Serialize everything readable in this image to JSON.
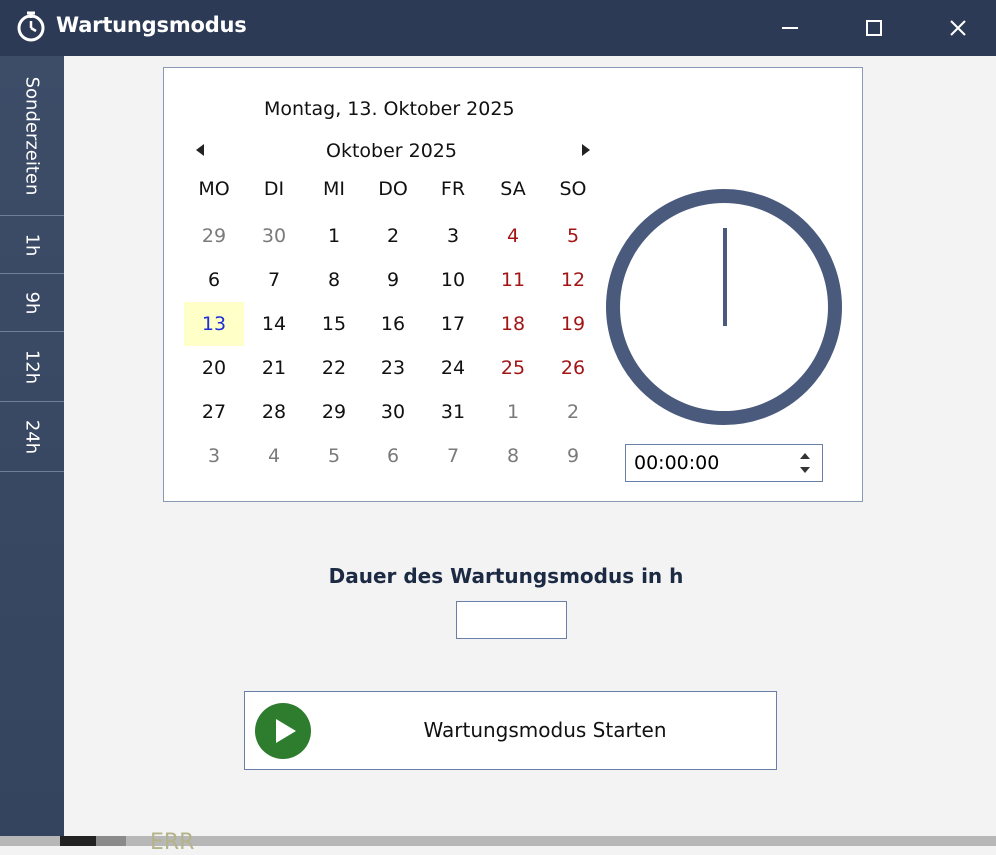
{
  "window": {
    "title": "Wartungsmodus",
    "title_icon": "clock-icon",
    "controls": [
      "minimize-icon",
      "maximize-icon",
      "close-icon"
    ]
  },
  "sidebar": {
    "items": [
      {
        "label": "Sonderzeiten"
      },
      {
        "label": "1h"
      },
      {
        "label": "9h"
      },
      {
        "label": "12h"
      },
      {
        "label": "24h"
      }
    ]
  },
  "calendar": {
    "selected_date_text": "Montag, 13. Oktober 2025",
    "month_label": "Oktober 2025",
    "weekdays": [
      "MO",
      "DI",
      "MI",
      "DO",
      "FR",
      "SA",
      "SO"
    ],
    "weeks": [
      [
        "29",
        "30",
        "1",
        "2",
        "3",
        "4",
        "5"
      ],
      [
        "6",
        "7",
        "8",
        "9",
        "10",
        "11",
        "12"
      ],
      [
        "13",
        "14",
        "15",
        "16",
        "17",
        "18",
        "19"
      ],
      [
        "20",
        "21",
        "22",
        "23",
        "24",
        "25",
        "26"
      ],
      [
        "27",
        "28",
        "29",
        "30",
        "31",
        "1",
        "2"
      ],
      [
        "3",
        "4",
        "5",
        "6",
        "7",
        "8",
        "9"
      ]
    ],
    "today": "13",
    "colors": {
      "weekend": "#a31515",
      "other_month": "#7a7a7a",
      "today_bg": "#ffffc8",
      "today_text": "#1e2fd8"
    }
  },
  "clock": {
    "time_value": "00:00:00",
    "ring_color": "#4a5a7c"
  },
  "duration": {
    "label": "Dauer des Wartungsmodus in h",
    "value": ""
  },
  "start_button": {
    "label": "Wartungsmodus Starten",
    "icon": "play-icon",
    "icon_color": "#2e7d2e"
  },
  "background_fragment": "ERR"
}
